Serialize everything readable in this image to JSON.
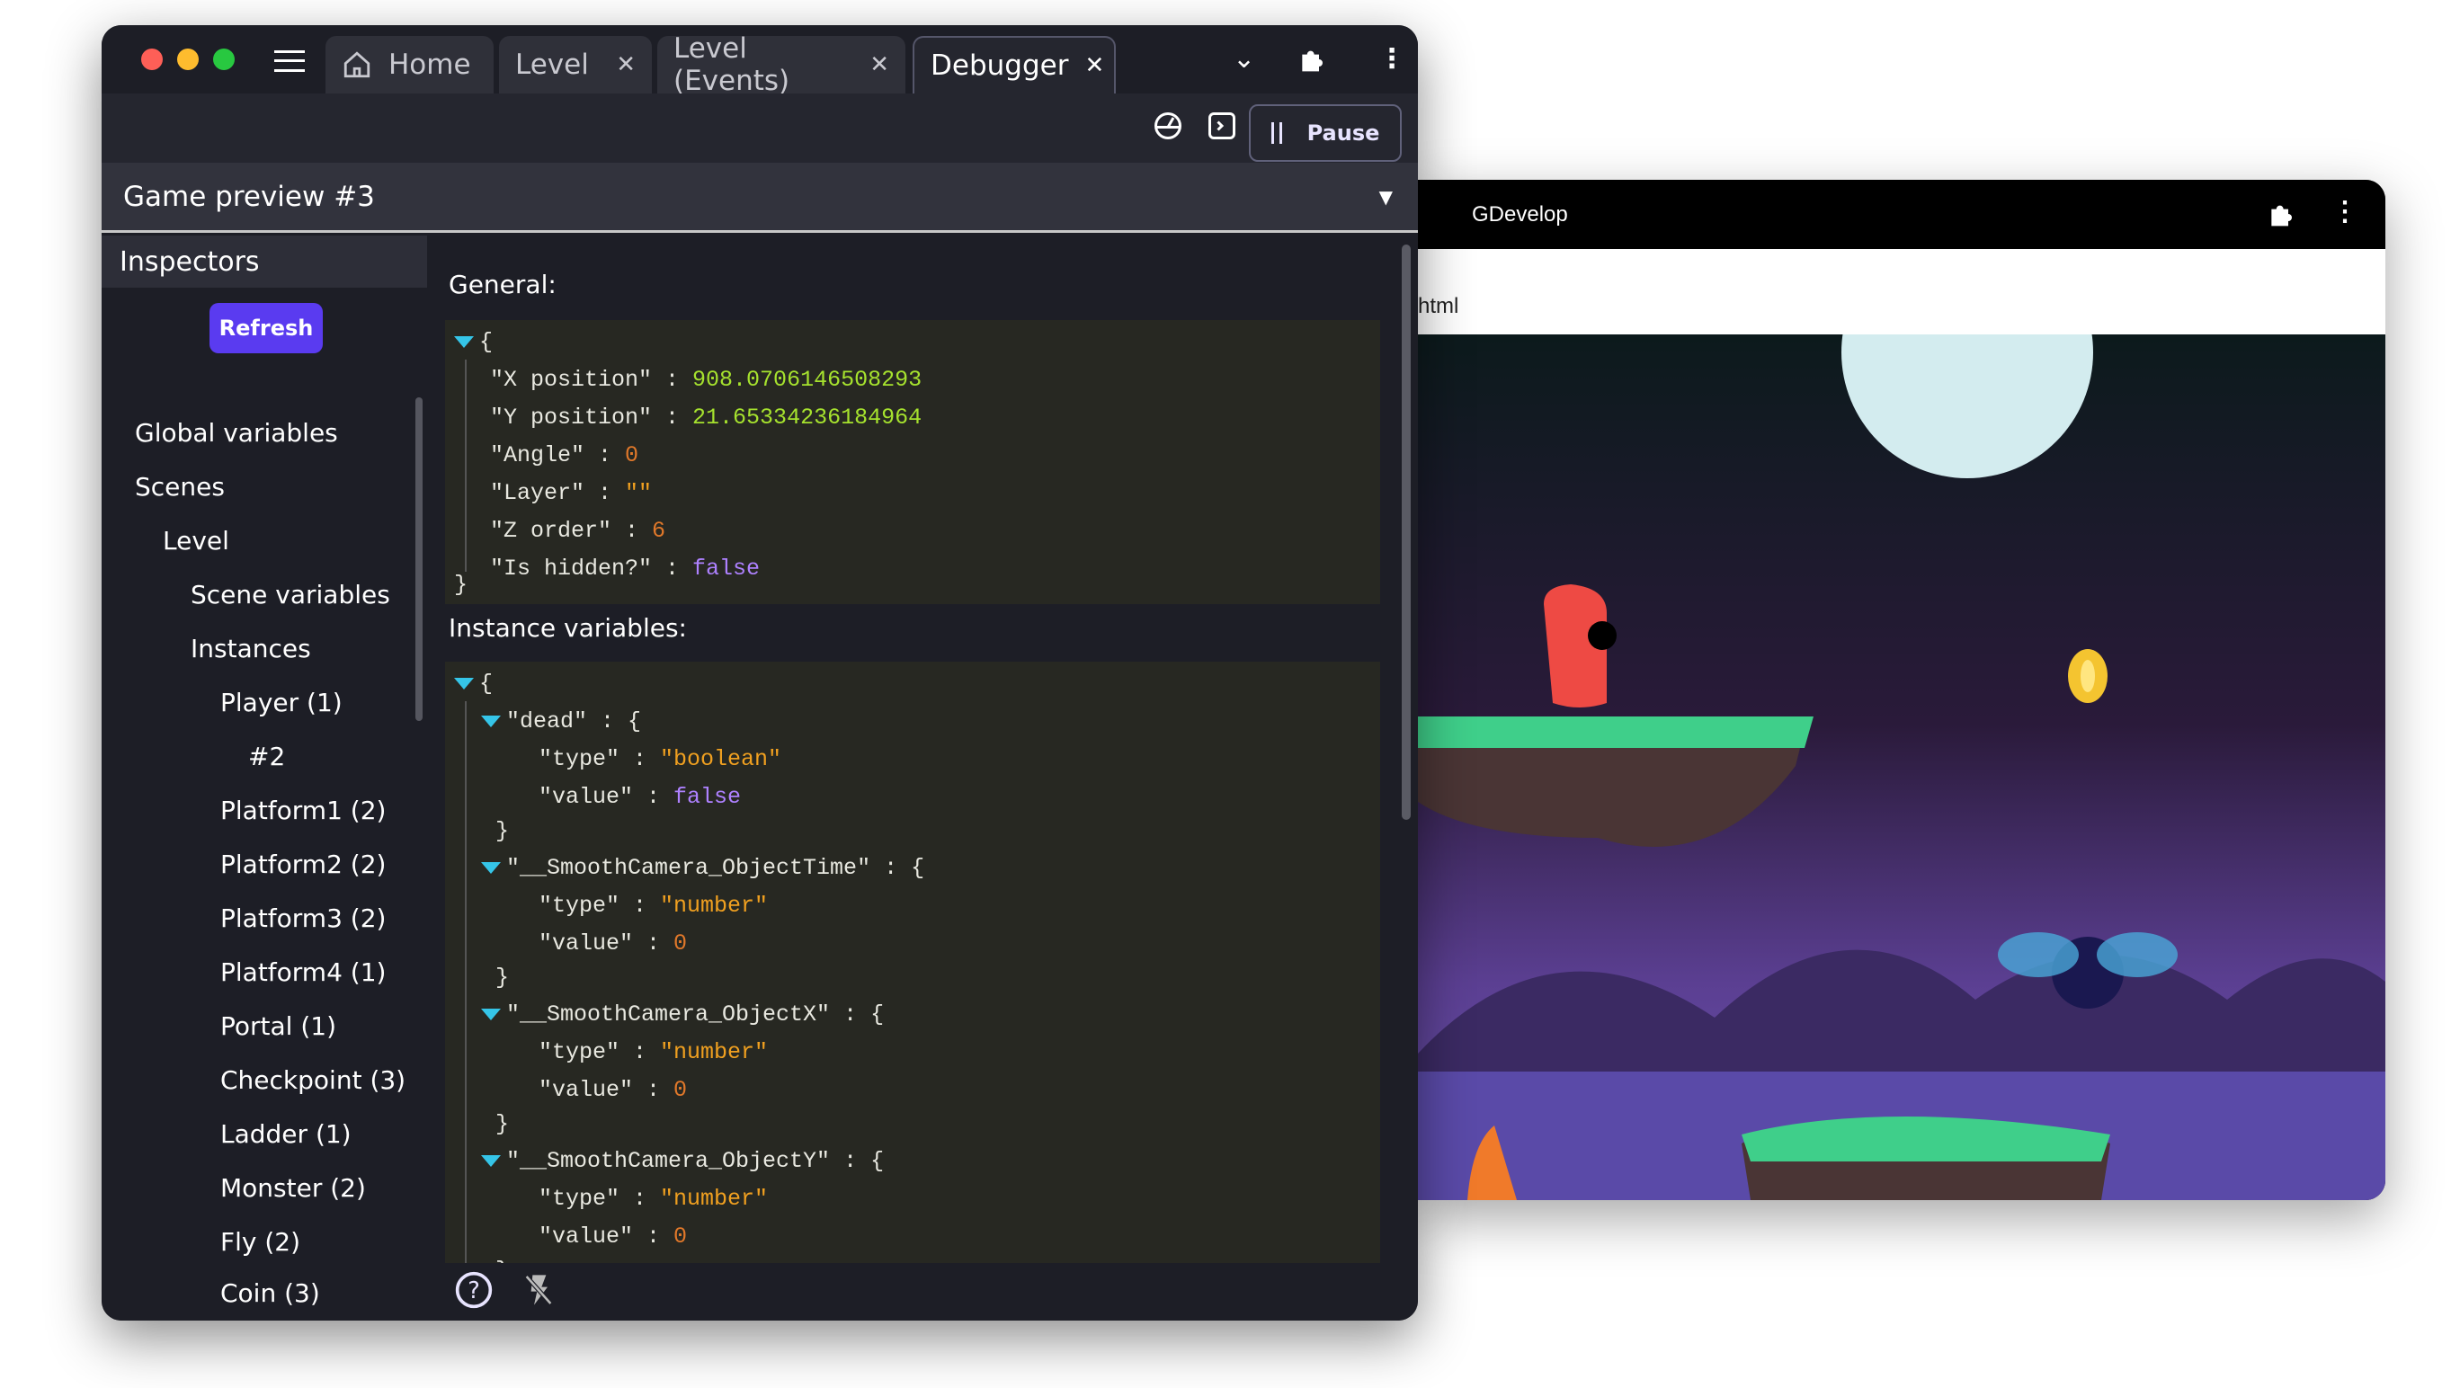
{
  "editor": {
    "tabs": [
      {
        "label": "Home",
        "icon": "home-icon"
      },
      {
        "label": "Level",
        "close": "✕"
      },
      {
        "label": "Level (Events)",
        "close": "✕"
      },
      {
        "label": "Debugger",
        "close": "✕",
        "active": true
      }
    ],
    "toolbar": {
      "pause_label": "Pause"
    },
    "preview_selector": "Game preview #3",
    "inspectors": {
      "title": "Inspectors",
      "refresh_label": "Refresh",
      "items": [
        "Global variables",
        "Scenes",
        "Level",
        "Scene variables",
        "Instances",
        "Player (1)",
        "#2",
        "Platform1 (2)",
        "Platform2 (2)",
        "Platform3 (2)",
        "Platform4 (1)",
        "Portal (1)",
        "Checkpoint (3)",
        "Ladder (1)",
        "Monster (2)",
        "Fly (2)",
        "Coin (3)"
      ]
    },
    "general": {
      "title": "General:",
      "fields": [
        {
          "key": "\"X position\"",
          "value": "908.0706146508293",
          "kind": "num"
        },
        {
          "key": "\"Y position\"",
          "value": "21.65334236184964",
          "kind": "num"
        },
        {
          "key": "\"Angle\"",
          "value": "0",
          "kind": "org"
        },
        {
          "key": "\"Layer\"",
          "value": "\"\"",
          "kind": "str"
        },
        {
          "key": "\"Z order\"",
          "value": "6",
          "kind": "org"
        },
        {
          "key": "\"Is hidden?\"",
          "value": "false",
          "kind": "bool"
        }
      ]
    },
    "instance_variables": {
      "title": "Instance variables:",
      "vars": [
        {
          "name": "\"dead\"",
          "type": "\"boolean\"",
          "value": "false",
          "vkind": "bool"
        },
        {
          "name": "\"__SmoothCamera_ObjectTime\"",
          "type": "\"number\"",
          "value": "0",
          "vkind": "org"
        },
        {
          "name": "\"__SmoothCamera_ObjectX\"",
          "type": "\"number\"",
          "value": "0",
          "vkind": "org"
        },
        {
          "name": "\"__SmoothCamera_ObjectY\"",
          "type": "\"number\"",
          "value": "0",
          "vkind": "org"
        }
      ]
    },
    "colors": {
      "accent": "#5a3bf0",
      "json_bg": "#272822",
      "number": "#a6e22e",
      "string": "#f0a020",
      "boolean": "#ae81ff",
      "caret": "#35c5e8"
    }
  },
  "game_window": {
    "title": "GDevelop",
    "address": "html"
  }
}
